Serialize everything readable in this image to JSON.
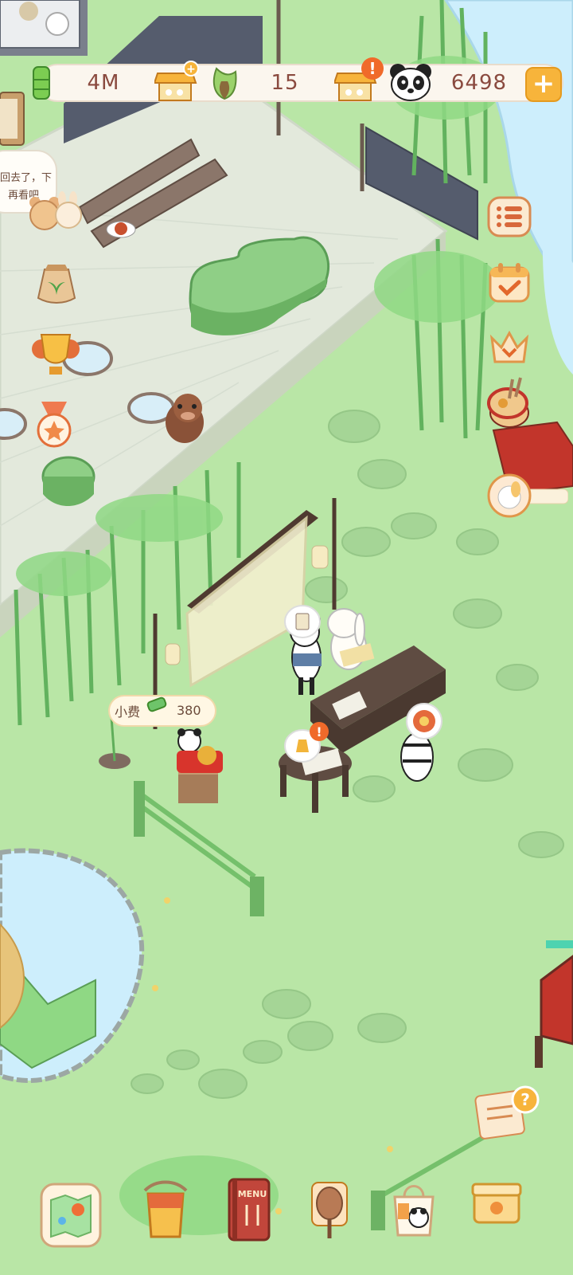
{
  "resources": {
    "bamboo_currency": "4M",
    "shoots_currency": "15",
    "panda_coins": "6498"
  },
  "npc_dialog": {
    "line1": "回去了，下",
    "line2": "再看吧"
  },
  "tip": {
    "label": "小费",
    "value": "380"
  },
  "menu_sign": "MENU",
  "colors": {
    "grass": "#b8e8a6",
    "floor": "#e3eadf",
    "bamboo": "#6ec46a",
    "accent": "#f7b43b",
    "alert": "#f06a2a",
    "text": "#8a4a3f",
    "water": "#cdeefc"
  },
  "icons": {
    "top_bar": [
      "bamboo-icon",
      "shop-add-icon",
      "bamboo-shoot-icon",
      "shop-alert-icon",
      "panda-icon",
      "plus-icon"
    ],
    "right_side": [
      "list-menu-icon",
      "calendar-check-icon",
      "crown-icon",
      "drum-event-icon",
      "character-avatar-icon"
    ],
    "left_side": [
      "seed-bag-icon",
      "trophy-icon",
      "medal-star-icon"
    ],
    "bottom_bar": [
      "map-icon",
      "paint-bucket-icon",
      "menu-book-icon",
      "decor-icon",
      "shopping-bag-icon",
      "storage-box-icon"
    ]
  }
}
